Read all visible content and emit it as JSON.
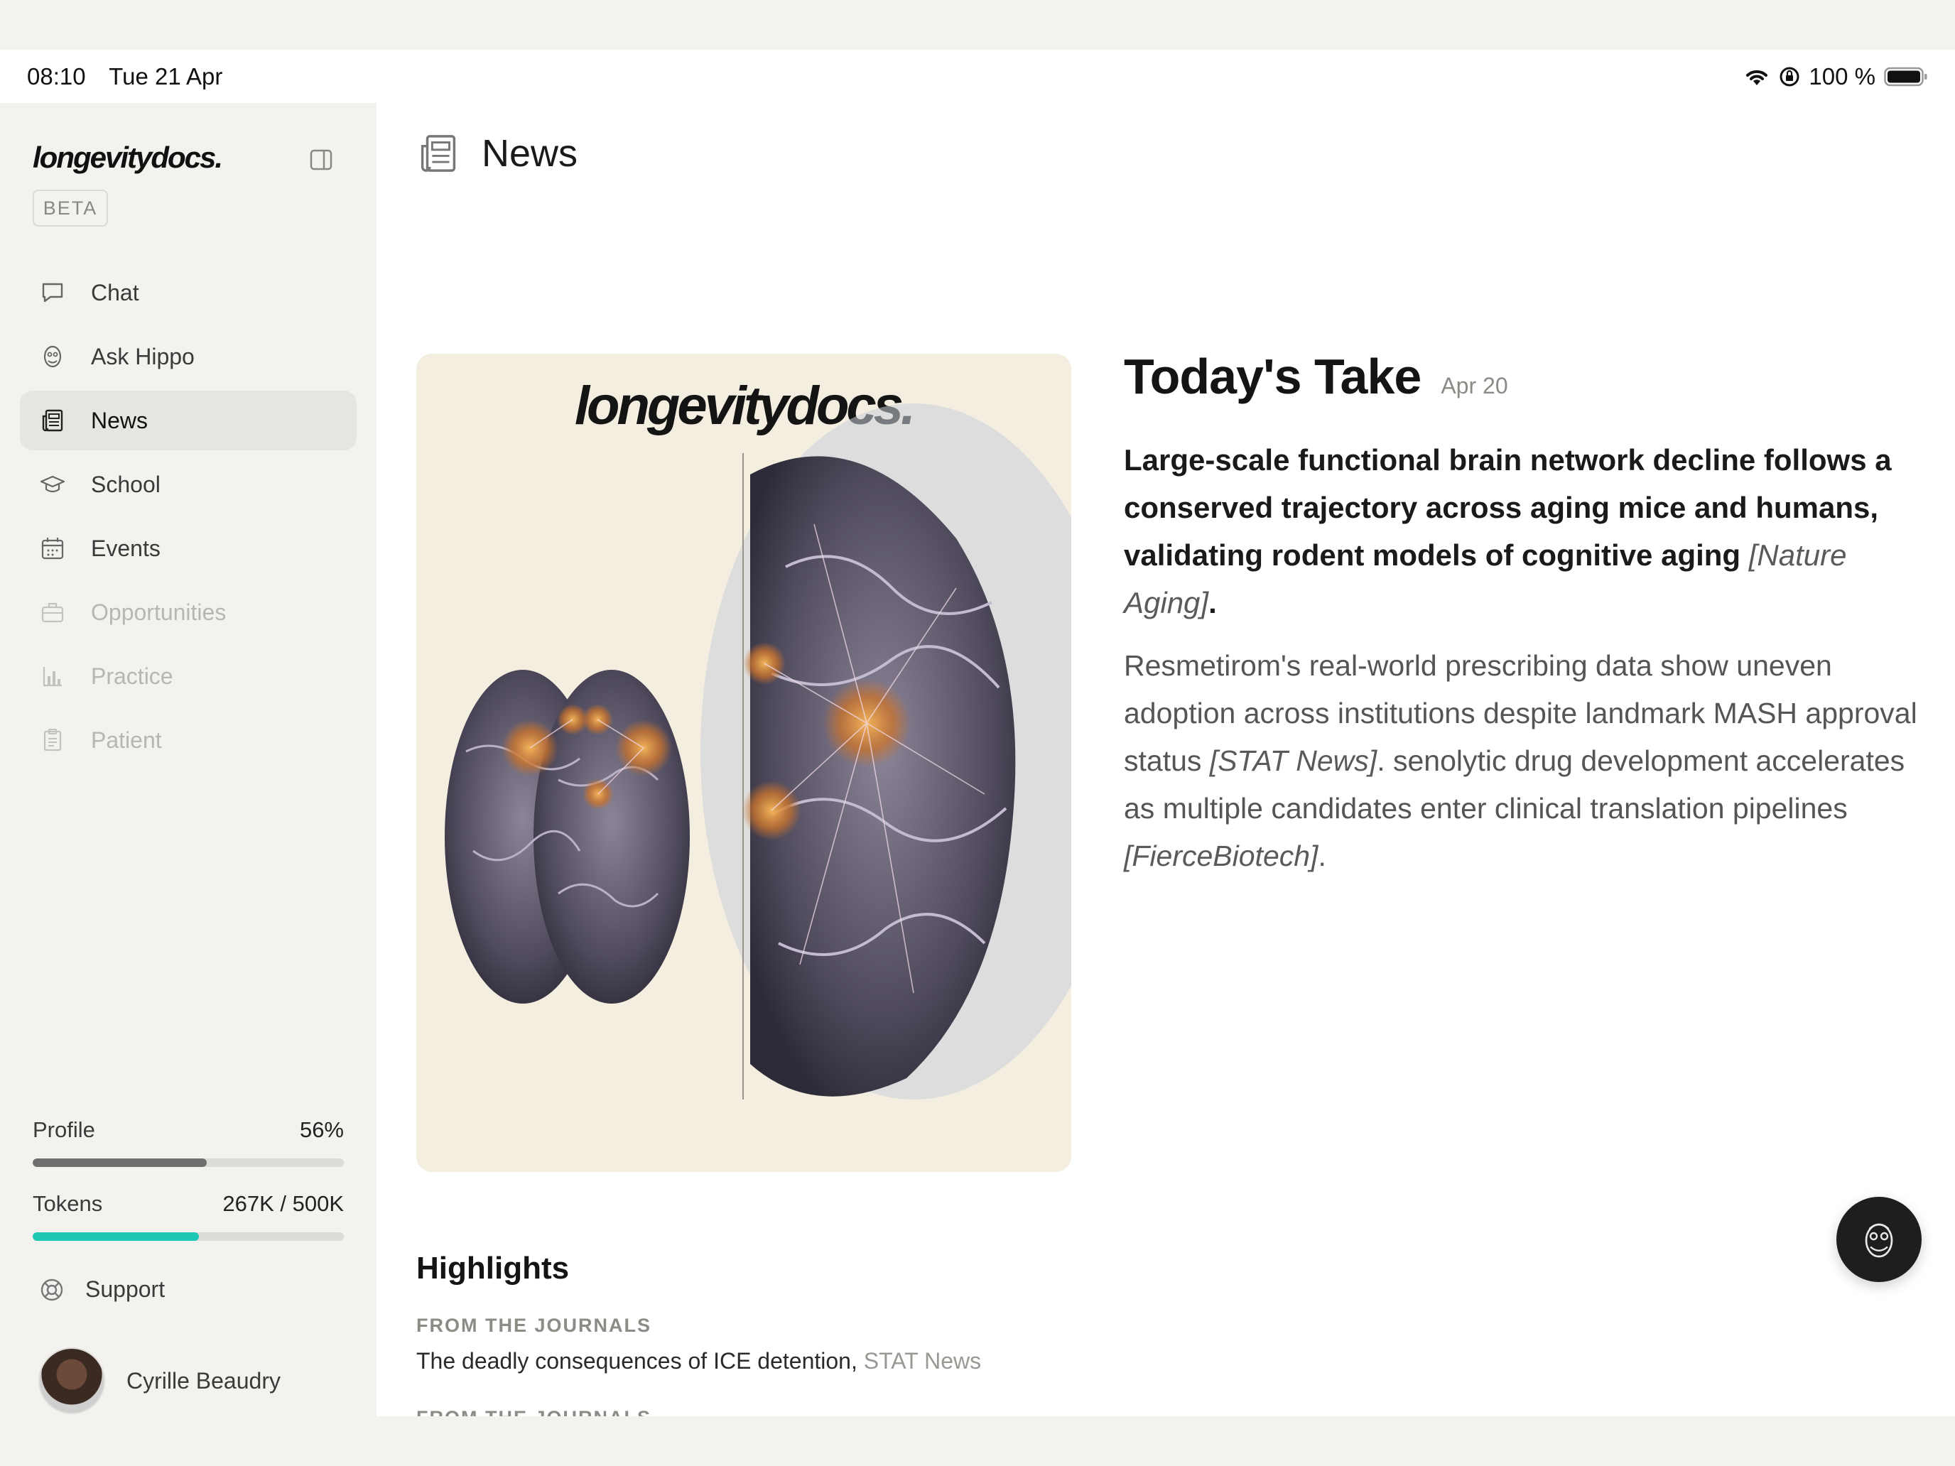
{
  "status": {
    "time": "08:10",
    "date": "Tue 21 Apr",
    "battery": "100 %"
  },
  "sidebar": {
    "logo": "longevitydocs.",
    "badge": "BETA",
    "items": [
      {
        "label": "Chat",
        "icon": "chat-bubble-icon",
        "state": "normal"
      },
      {
        "label": "Ask Hippo",
        "icon": "hippo-icon",
        "state": "normal"
      },
      {
        "label": "News",
        "icon": "newspaper-icon",
        "state": "active"
      },
      {
        "label": "School",
        "icon": "graduation-cap-icon",
        "state": "normal"
      },
      {
        "label": "Events",
        "icon": "calendar-icon",
        "state": "normal"
      },
      {
        "label": "Opportunities",
        "icon": "briefcase-icon",
        "state": "disabled"
      },
      {
        "label": "Practice",
        "icon": "bar-chart-icon",
        "state": "disabled"
      },
      {
        "label": "Patient",
        "icon": "clipboard-icon",
        "state": "disabled"
      }
    ],
    "profile": {
      "label": "Profile",
      "value": "56%",
      "fraction": 0.56,
      "color": "#6f6f6f"
    },
    "tokens": {
      "label": "Tokens",
      "value": "267K / 500K",
      "fraction": 0.534,
      "color": "#1cc7b4"
    },
    "support": "Support",
    "user": "Cyrille Beaudry"
  },
  "main": {
    "title": "News",
    "hero_logo": "longevitydocs.",
    "take": {
      "title": "Today's Take",
      "date": "Apr 20",
      "lead": "Large-scale functional brain network decline follows a conserved trajectory across aging mice and humans, validating rodent models of cognitive aging",
      "lead_source": "[Nature Aging]",
      "body_1": "Resmetirom's real-world prescribing data show uneven adoption across institutions despite landmark MASH approval status",
      "body_source_1": "[STAT News]",
      "body_2": ". senolytic drug development accelerates as multiple candidates enter clinical translation pipelines",
      "body_source_2": "[FierceBiotech]"
    },
    "highlights": {
      "title": "Highlights",
      "items": [
        {
          "kicker": "FROM THE JOURNALS",
          "headline": "The deadly consequences of ICE detention",
          "source": "STAT News"
        },
        {
          "kicker": "FROM THE JOURNALS"
        }
      ]
    }
  }
}
